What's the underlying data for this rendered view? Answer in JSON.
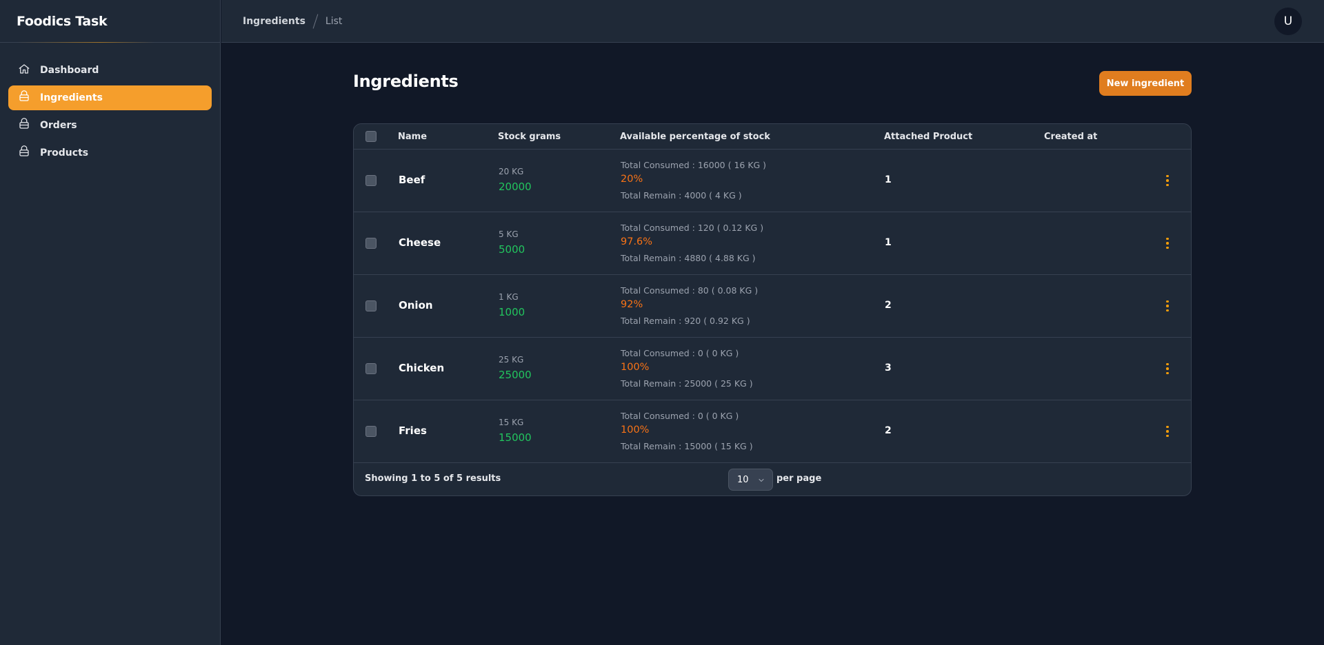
{
  "app": {
    "title": "Foodics Task"
  },
  "sidebar": {
    "items": [
      {
        "label": "Dashboard",
        "icon": "home-icon",
        "active": false
      },
      {
        "label": "Ingredients",
        "icon": "box-icon",
        "active": true
      },
      {
        "label": "Orders",
        "icon": "box-icon",
        "active": false
      },
      {
        "label": "Products",
        "icon": "box-icon",
        "active": false
      }
    ]
  },
  "breadcrumb": {
    "parent": "Ingredients",
    "current": "List"
  },
  "user": {
    "initial": "U"
  },
  "page": {
    "title": "Ingredients",
    "new_button": "New ingredient"
  },
  "table": {
    "headers": {
      "name": "Name",
      "stock": "Stock grams",
      "available": "Available percentage of stock",
      "attached": "Attached Product",
      "created": "Created at"
    },
    "rows": [
      {
        "name": "Beef",
        "stock_kg": "20 KG",
        "stock_g": "20000",
        "consumed": "Total Consumed : 16000 ( 16 KG )",
        "pct": "20%",
        "remain": "Total Remain : 4000 ( 4 KG )",
        "attached": "1",
        "created": ""
      },
      {
        "name": "Cheese",
        "stock_kg": "5 KG",
        "stock_g": "5000",
        "consumed": "Total Consumed : 120 ( 0.12 KG )",
        "pct": "97.6%",
        "remain": "Total Remain : 4880 ( 4.88 KG )",
        "attached": "1",
        "created": ""
      },
      {
        "name": "Onion",
        "stock_kg": "1 KG",
        "stock_g": "1000",
        "consumed": "Total Consumed : 80 ( 0.08 KG )",
        "pct": "92%",
        "remain": "Total Remain : 920 ( 0.92 KG )",
        "attached": "2",
        "created": ""
      },
      {
        "name": "Chicken",
        "stock_kg": "25 KG",
        "stock_g": "25000",
        "consumed": "Total Consumed : 0 ( 0 KG )",
        "pct": "100%",
        "remain": "Total Remain : 25000 ( 25 KG )",
        "attached": "3",
        "created": ""
      },
      {
        "name": "Fries",
        "stock_kg": "15 KG",
        "stock_g": "15000",
        "consumed": "Total Consumed : 0 ( 0 KG )",
        "pct": "100%",
        "remain": "Total Remain : 15000 ( 15 KG )",
        "attached": "2",
        "created": ""
      }
    ],
    "footer": {
      "showing": "Showing 1 to 5 of 5 results",
      "per_page_value": "10",
      "per_page_label": "per page"
    }
  },
  "colors": {
    "accent": "#f59e2c",
    "button": "#e07d1f",
    "stock_green": "#22c55e",
    "percent_orange": "#f97316",
    "background": "#111827",
    "panel": "#1f2937"
  }
}
